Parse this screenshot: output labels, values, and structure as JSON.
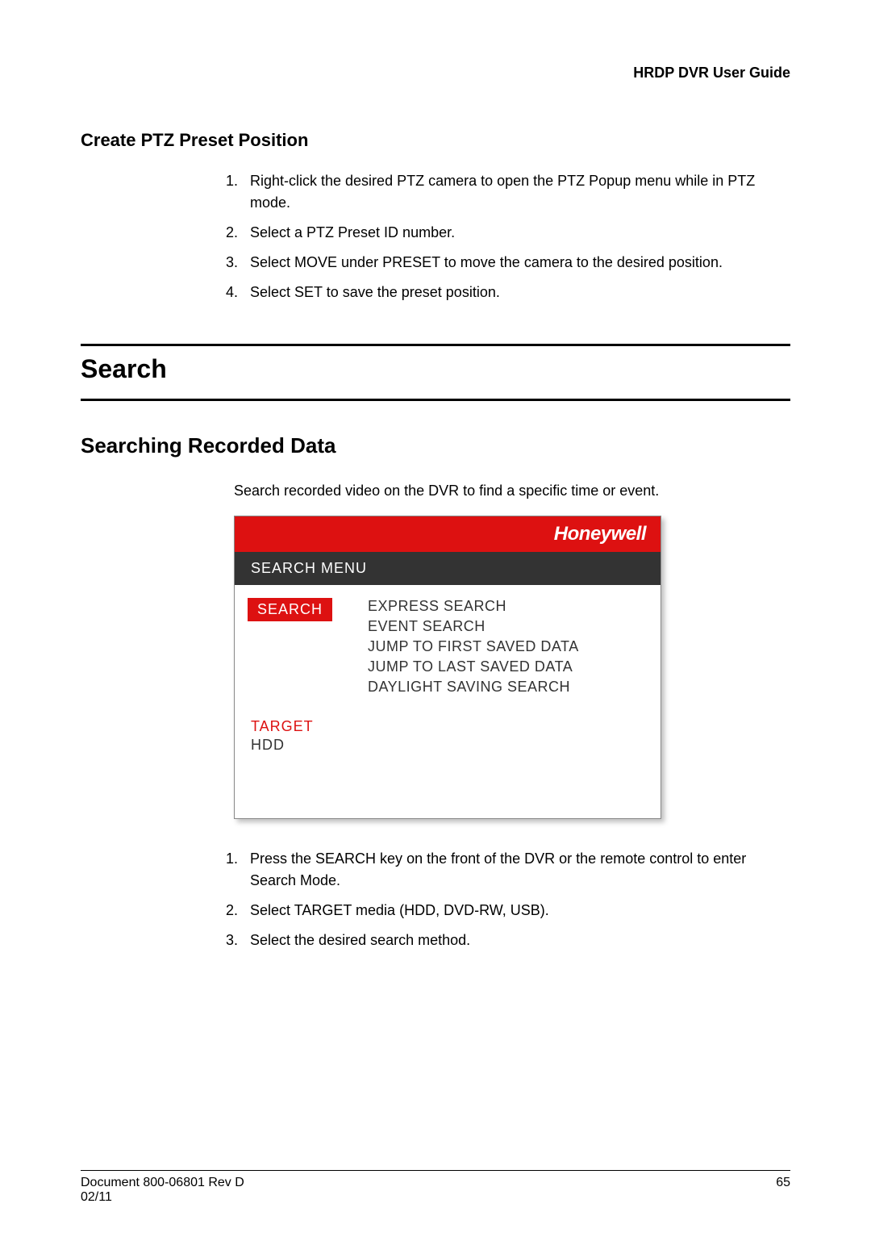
{
  "header": {
    "doc_title": "HRDP DVR User Guide"
  },
  "section1": {
    "title": "Create PTZ Preset Position",
    "steps": [
      "Right-click the desired PTZ camera to open the PTZ Popup menu while in PTZ mode.",
      "Select a PTZ Preset ID number.",
      "Select MOVE under PRESET to move the camera to the desired position.",
      "Select SET to save the preset position."
    ]
  },
  "section2": {
    "title": "Search"
  },
  "section3": {
    "title": "Searching Recorded Data",
    "intro": "Search recorded video on the DVR to find a specific time or event.",
    "steps": [
      "Press the SEARCH key on the front of the DVR or the remote control to enter Search Mode.",
      "Select TARGET media (HDD, DVD-RW, USB).",
      "Select the desired search method."
    ]
  },
  "screenshot": {
    "brand": "Honeywell",
    "menu_title": "SEARCH MENU",
    "left": {
      "tab_active": "SEARCH",
      "target_label": "TARGET",
      "target_value": "HDD"
    },
    "right_options": [
      "EXPRESS SEARCH",
      "EVENT SEARCH",
      "JUMP TO FIRST SAVED DATA",
      "JUMP TO LAST SAVED DATA",
      "DAYLIGHT SAVING SEARCH"
    ]
  },
  "footer": {
    "left_line1": "Document 800-06801  Rev D",
    "left_line2": "02/11",
    "page": "65"
  }
}
